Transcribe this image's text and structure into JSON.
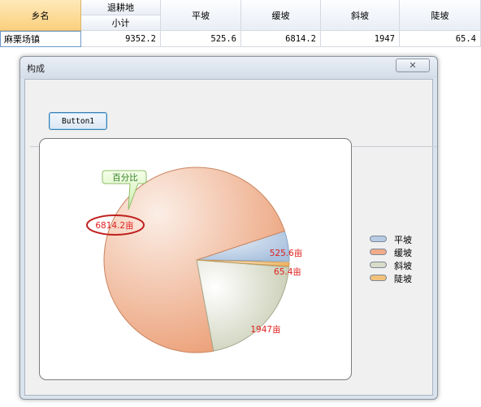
{
  "grid": {
    "headers": {
      "township": "乡名",
      "retired_farmland": "退耕地",
      "subtotal": "小计",
      "flat": "平坡",
      "gentle": "缓坡",
      "inclined": "斜坡",
      "steep": "陡坡"
    },
    "row": {
      "township": "麻栗场镇",
      "subtotal": "9352.2",
      "flat": "525.6",
      "gentle": "6814.2",
      "inclined": "1947",
      "steep": "65.4"
    }
  },
  "dialog": {
    "title": "构成",
    "close_glyph": "✕",
    "button1_label": "Button1"
  },
  "chart_data": {
    "type": "pie",
    "title": "",
    "slices": [
      {
        "name": "平坡",
        "value": 525.6,
        "label": "525.6亩",
        "color": "#b7cce3"
      },
      {
        "name": "缓坡",
        "value": 6814.2,
        "label": "6814.2亩",
        "color": "#f0ac88"
      },
      {
        "name": "斜坡",
        "value": 1947,
        "label": "1947亩",
        "color": "#d9dcc8"
      },
      {
        "name": "陡坡",
        "value": 65.4,
        "label": "65.4亩",
        "color": "#f2c27a"
      }
    ],
    "callout": "百分比",
    "legend_position": "right",
    "label_color": "#e0201e"
  }
}
